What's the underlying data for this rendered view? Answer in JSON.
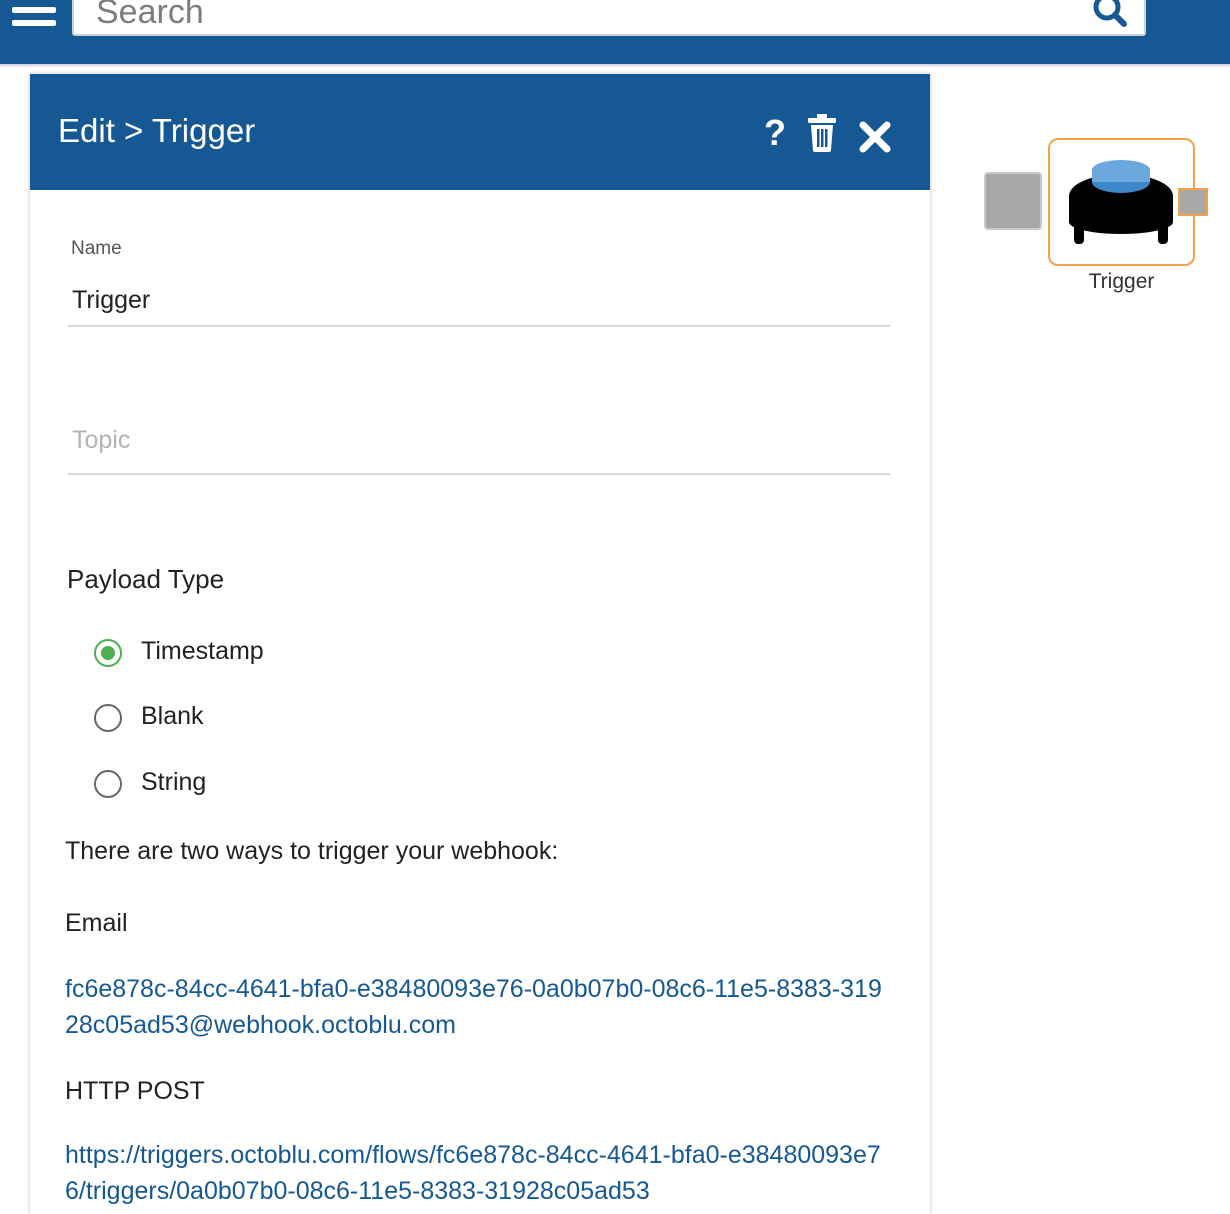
{
  "topbar": {
    "search_placeholder": "Search"
  },
  "panel": {
    "title": "Edit > Trigger",
    "icons": [
      "help-icon",
      "trash-icon",
      "close-icon"
    ],
    "name_label": "Name",
    "name_value": "Trigger",
    "topic_placeholder": "Topic",
    "payload_title": "Payload Type",
    "payload_options": [
      {
        "label": "Timestamp",
        "checked": true
      },
      {
        "label": "Blank",
        "checked": false
      },
      {
        "label": "String",
        "checked": false
      }
    ],
    "intro": "There are two ways to trigger your webhook:",
    "email_heading": "Email",
    "email_address": "fc6e878c-84cc-4641-bfa0-e38480093e76-0a0b07b0-08c6-11e5-8383-31928c05ad53@webhook.octoblu.com",
    "http_heading": "HTTP POST",
    "http_url": "https://triggers.octoblu.com/flows/fc6e878c-84cc-4641-bfa0-e38480093e76/triggers/0a0b07b0-08c6-11e5-8383-31928c05ad53"
  },
  "node": {
    "label": "Trigger"
  },
  "colors": {
    "primary": "#155894",
    "radio_checked": "#4caf50",
    "node_border": "#f4a14a",
    "link": "#155894"
  }
}
